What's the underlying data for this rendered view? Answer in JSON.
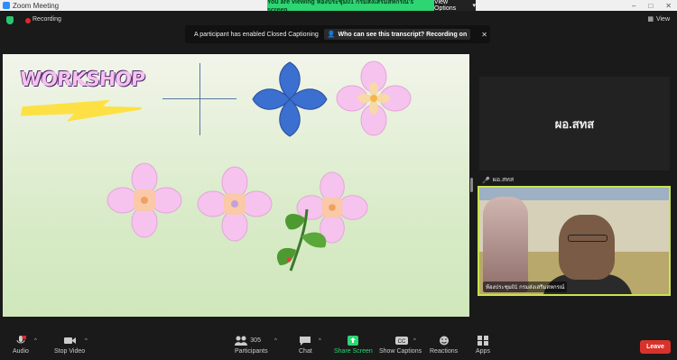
{
  "window": {
    "title": "Zoom Meeting",
    "controls": [
      "–",
      "□",
      "✕"
    ]
  },
  "share_banner": {
    "message": "You are viewing ห้องประชุม01 กรมส่งเสริมสหกรณ์'s screen",
    "view_options": "View Options"
  },
  "top": {
    "recording": "Recording",
    "view": "View"
  },
  "cc_notice": {
    "text": "A participant has enabled Closed Captioning",
    "who_link": "Who can see this transcript? Recording on",
    "close": "✕"
  },
  "shared_content": {
    "logo_text": "WORKSHOP"
  },
  "participants": {
    "tile1_name": "ผอ.สทส",
    "tile1_label": "ผอ.สทส",
    "cam_label": "ห้องประชุม01 กรมส่งเสริมสหกรณ์"
  },
  "toolbar": {
    "audio": "Audio",
    "audio_badge": "1",
    "stop_video": "Stop Video",
    "participants": "Participants",
    "participants_count": "305",
    "chat": "Chat",
    "share_screen": "Share Screen",
    "show_captions": "Show Captions",
    "reactions": "Reactions",
    "apps": "Apps",
    "leave": "Leave"
  },
  "colors": {
    "accent_green": "#2ed573",
    "leave_red": "#d9322b",
    "active_border": "#c9e24f"
  }
}
